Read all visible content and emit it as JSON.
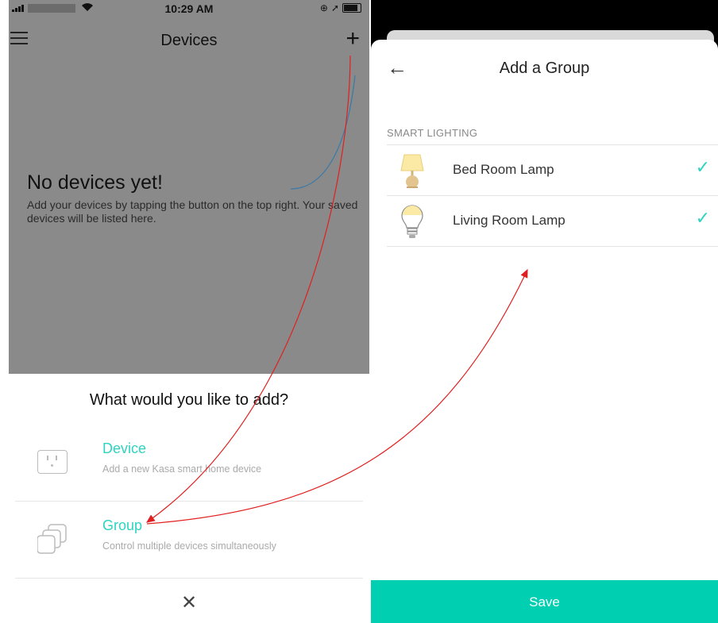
{
  "left_screen": {
    "status": {
      "time": "10:29 AM"
    },
    "nav": {
      "title": "Devices",
      "menu_icon": "hamburger-icon",
      "add_icon": "plus-icon"
    },
    "empty_state": {
      "title": "No devices yet!",
      "description": "Add your devices by tapping the button on the top right.  Your saved devices will be listed here."
    },
    "add_sheet": {
      "title": "What would you like to add?",
      "options": [
        {
          "label": "Device",
          "description": "Add a new Kasa smart home device",
          "icon": "outlet-icon"
        },
        {
          "label": "Group",
          "description": "Control multiple devices simultaneously",
          "icon": "stacked-squares-icon"
        }
      ],
      "close_icon": "close-icon",
      "close_glyph": "✕"
    }
  },
  "right_screen": {
    "header": {
      "title": "Add a Group",
      "back_icon": "back-arrow-icon",
      "back_glyph": "←"
    },
    "section": "SMART LIGHTING",
    "devices": [
      {
        "name": "Bed Room Lamp",
        "icon": "table-lamp-icon",
        "selected": true,
        "check": "✓"
      },
      {
        "name": "Living Room Lamp",
        "icon": "light-bulb-icon",
        "selected": true,
        "check": "✓"
      }
    ],
    "save_label": "Save"
  },
  "colors": {
    "accent": "#2dd4c0",
    "save_bar": "#00cfb1",
    "annotation_arrow": "#e02020",
    "dim_overlay": "#8a8a8a"
  }
}
